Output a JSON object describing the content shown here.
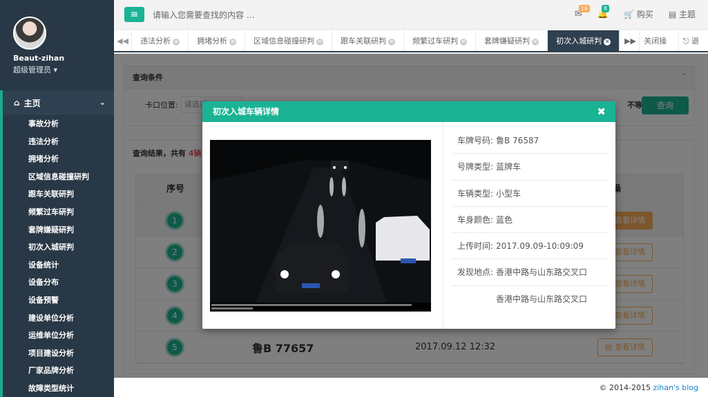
{
  "user": {
    "name": "Beaut-zihan",
    "role": "超级管理员"
  },
  "nav": {
    "home": "主页",
    "items": [
      "事故分析",
      "违法分析",
      "拥堵分析",
      "区域信息碰撞研判",
      "跟车关联研判",
      "频繁过车研判",
      "套牌嫌疑研判",
      "初次入城研判",
      "设备统计",
      "设备分布",
      "设备预警",
      "建设单位分析",
      "运维单位分析",
      "项目建设分析",
      "厂家品牌分析",
      "故障类型统计"
    ]
  },
  "header": {
    "search_placeholder": "请输入您需要查找的内容 …",
    "mail_count": "16",
    "bell_count": "8",
    "buy": "购买",
    "theme": "主题"
  },
  "tabs": {
    "items": [
      "违法分析",
      "拥堵分析",
      "区域信息碰撞研判",
      "跟车关联研判",
      "频繁过车研判",
      "套牌嫌疑研判"
    ],
    "active": "初次入城研判",
    "close_ops": "关闭操作",
    "logout": "退出"
  },
  "query": {
    "title": "查询条件",
    "location_label": "卡口位置:",
    "location_placeholder": "请选择",
    "not_equal": "不等于",
    "button": "查询"
  },
  "results": {
    "prefix": "查询结果，共有",
    "count": "4辆",
    "suffix": "车",
    "col_no": "序号",
    "col_action": "操",
    "detail_btn": "查看详情",
    "rows": [
      {
        "no": "1",
        "plate": "",
        "time": ""
      },
      {
        "no": "2",
        "plate": "",
        "time": ""
      },
      {
        "no": "3",
        "plate": "",
        "time": ""
      },
      {
        "no": "4",
        "plate": "",
        "time": ""
      },
      {
        "no": "5",
        "plate": "鲁B 77657",
        "time": "2017.09.12 12:32"
      }
    ]
  },
  "modal": {
    "title": "初次入城车辆详情",
    "fields": [
      {
        "k": "车牌号码:",
        "v": "鲁B 76587"
      },
      {
        "k": "号牌类型:",
        "v": "蓝牌车"
      },
      {
        "k": "车辆类型:",
        "v": "小型车"
      },
      {
        "k": "车身颜色:",
        "v": "蓝色"
      },
      {
        "k": "上传时间:",
        "v": "2017.09.09-10:09:09"
      },
      {
        "k": "发现地点:",
        "v": "香港中路与山东路交叉口"
      },
      {
        "k": "",
        "v": "香港中路与山东路交叉口"
      }
    ]
  },
  "footer": {
    "copy": "© 2014-2015",
    "link": "zihan's blog"
  }
}
